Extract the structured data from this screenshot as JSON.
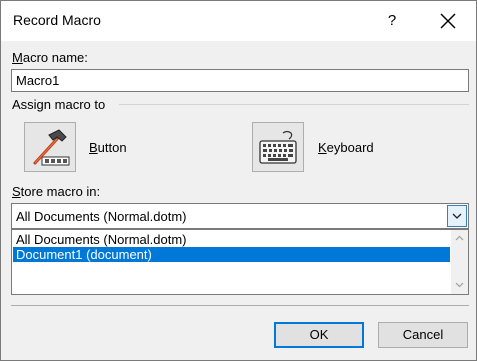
{
  "window": {
    "title": "Record Macro",
    "help_glyph": "?"
  },
  "macro_name": {
    "label_mnemonic": "M",
    "label_rest": "acro name:",
    "value": "Macro1"
  },
  "assign": {
    "heading": "Assign macro to",
    "button_mnemonic": "B",
    "button_rest": "utton",
    "keyboard_mnemonic": "K",
    "keyboard_rest": "eyboard"
  },
  "store": {
    "label_mnemonic": "S",
    "label_rest": "tore macro in:",
    "selected_value": "All Documents (Normal.dotm)",
    "options": [
      {
        "label": "All Documents (Normal.dotm)",
        "highlighted": false
      },
      {
        "label": "Document1 (document)",
        "highlighted": true
      }
    ]
  },
  "footer": {
    "ok_label": "OK",
    "cancel_label": "Cancel"
  },
  "colors": {
    "selection": "#0078d7",
    "dialog_bg": "#f0f0f0"
  },
  "icons": {
    "help": "question-mark",
    "close": "x-close-icon",
    "button": "hammer-toolbar-icon",
    "keyboard": "keyboard-icon",
    "dropdown": "chevron-down-icon"
  }
}
